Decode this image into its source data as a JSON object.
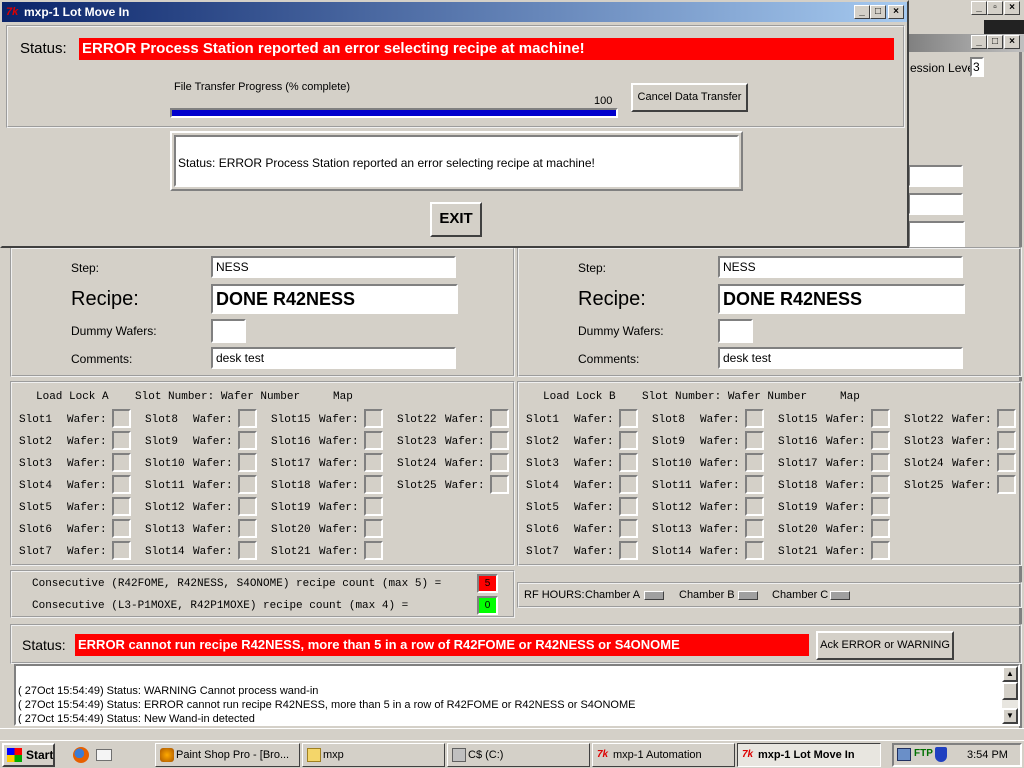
{
  "colors": {
    "error": "#ff0000",
    "ok": "#00ff00",
    "title": "#0a246a"
  },
  "dialog": {
    "title": "mxp-1 Lot Move In",
    "status_label": "Status:",
    "status_text": "ERROR Process Station reported an error selecting recipe at machine!",
    "progress_label": "File Transfer Progress (% complete)",
    "progress_value_text": "100",
    "progress_fraction": 1.0,
    "cancel_label": "Cancel Data Transfer",
    "message_text": "Status: ERROR Process Station reported an error selecting recipe at machine!",
    "exit_label": "EXIT"
  },
  "main": {
    "session_label": "ession Level:",
    "session_value": "3",
    "panels": [
      {
        "step_label": "Step:",
        "step_value": "NESS",
        "recipe_label": "Recipe:",
        "recipe_value": "DONE R42NESS",
        "dummy_label": "Dummy Wafers:",
        "dummy_value": "",
        "comments_label": "Comments:",
        "comments_value": "desk test"
      },
      {
        "step_label": "Step:",
        "step_value": "NESS",
        "recipe_label": "Recipe:",
        "recipe_value": "DONE R42NESS",
        "dummy_label": "Dummy Wafers:",
        "dummy_value": "",
        "comments_label": "Comments:",
        "comments_value": "desk test"
      }
    ],
    "loadlocks": [
      {
        "header": "Load Lock A    Slot Number: Wafer Number     Map"
      },
      {
        "header": "Load Lock B    Slot Number: Wafer Number     Map"
      }
    ],
    "wafer_label": "Wafer:",
    "slot_columns": [
      [
        "Slot1",
        "Slot2",
        "Slot3",
        "Slot4",
        "Slot5",
        "Slot6",
        "Slot7"
      ],
      [
        "Slot8",
        "Slot9",
        "Slot10",
        "Slot11",
        "Slot12",
        "Slot13",
        "Slot14"
      ],
      [
        "Slot15",
        "Slot16",
        "Slot17",
        "Slot18",
        "Slot19",
        "Slot20",
        "Slot21"
      ],
      [
        "Slot22",
        "Slot23",
        "Slot24",
        "Slot25"
      ]
    ],
    "consecutive": [
      {
        "text": "Consecutive (R42FOME, R42NESS, S4ONOME) recipe count (max 5) =",
        "value": "5",
        "color": "#ff0000"
      },
      {
        "text": "Consecutive (L3-P1MOXE, R42P1MOXE) recipe count (max 4) =",
        "value": "0",
        "color": "#00ff00"
      }
    ],
    "rf": {
      "label": "RF HOURS:",
      "chambers": [
        "Chamber A",
        "Chamber B",
        "Chamber C"
      ]
    },
    "bottom_status_label": "Status:",
    "bottom_status_text": "ERROR cannot run recipe R42NESS, more than 5 in a row of R42FOME or R42NESS or S4ONOME",
    "ack_label": "Ack ERROR or WARNING",
    "log": [
      "( 27Oct 15:54:49) Status: WARNING Cannot process wand-in",
      "( 27Oct 15:54:49) Status: ERROR cannot run recipe R42NESS, more than 5 in a row of R42FOME or R42NESS or S4ONOME",
      "( 27Oct 15:54:49) Status: New Wand-in detected"
    ]
  },
  "taskbar": {
    "start_label": "Start",
    "tasks": [
      {
        "label": "Paint Shop Pro - [Bro...",
        "icon": "paint-shop-pro-icon"
      },
      {
        "label": "mxp",
        "icon": "folder-search-icon"
      },
      {
        "label": "C$ (C:)",
        "icon": "drive-icon"
      },
      {
        "label": "mxp-1 Automation",
        "icon": "tk-icon"
      },
      {
        "label": "mxp-1 Lot Move In",
        "icon": "tk-icon"
      }
    ],
    "tray_ftp": "FTP",
    "clock": "3:54 PM"
  }
}
